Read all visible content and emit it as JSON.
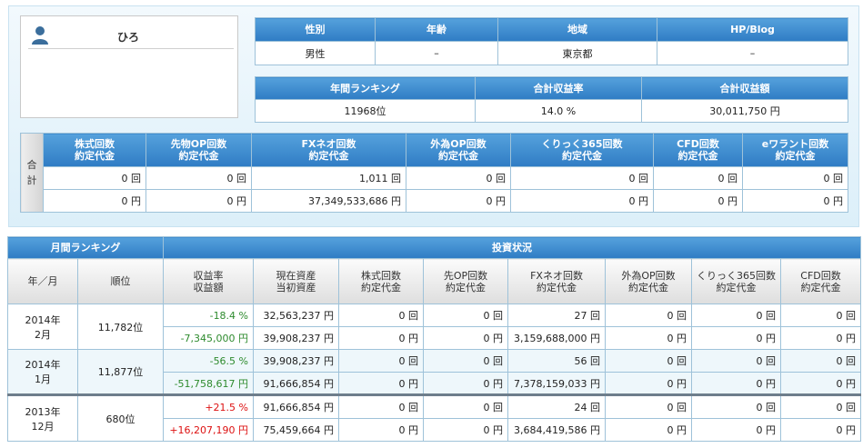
{
  "profile": {
    "name": "ひろ"
  },
  "info": {
    "headers": [
      "性別",
      "年齢",
      "地域",
      "HP/Blog"
    ],
    "values": [
      "男性",
      "–",
      "東京都",
      "–"
    ]
  },
  "summary": {
    "headers": [
      "年間ランキング",
      "合計収益率",
      "合計収益額"
    ],
    "values": [
      "11968位",
      "14.0 %",
      "30,011,750 円"
    ]
  },
  "totals": {
    "side_label": [
      "合",
      "計"
    ],
    "headers": [
      [
        "株式回数",
        "約定代金"
      ],
      [
        "先物OP回数",
        "約定代金"
      ],
      [
        "FXネオ回数",
        "約定代金"
      ],
      [
        "外為OP回数",
        "約定代金"
      ],
      [
        "くりっく365回数",
        "約定代金"
      ],
      [
        "CFD回数",
        "約定代金"
      ],
      [
        "eワラント回数",
        "約定代金"
      ]
    ],
    "counts": [
      "0 回",
      "0 回",
      "1,011 回",
      "0 回",
      "0 回",
      "0 回",
      "0 回"
    ],
    "amounts": [
      "0 円",
      "0 円",
      "37,349,533,686 円",
      "0 円",
      "0 円",
      "0 円",
      "0 円"
    ]
  },
  "monthly": {
    "ranking_header": "月間ランキング",
    "status_header": "投資状況",
    "columns": [
      [
        "年／月"
      ],
      [
        "順位"
      ],
      [
        "収益率",
        "収益額"
      ],
      [
        "現在資産",
        "当初資産"
      ],
      [
        "株式回数",
        "約定代金"
      ],
      [
        "先OP回数",
        "約定代金"
      ],
      [
        "FXネオ回数",
        "約定代金"
      ],
      [
        "外為OP回数",
        "約定代金"
      ],
      [
        "くりっく365回数",
        "約定代金"
      ],
      [
        "CFD回数",
        "約定代金"
      ]
    ],
    "rows": [
      {
        "ym": [
          "2014年",
          "2月"
        ],
        "rank": "11,782位",
        "line1": [
          "-18.4 %",
          "32,563,237 円",
          "0 回",
          "0 回",
          "27 回",
          "0 回",
          "0 回",
          "0 回"
        ],
        "line2": [
          "-7,345,000 円",
          "39,908,237 円",
          "0 円",
          "0 円",
          "3,159,688,000 円",
          "0 円",
          "0 円",
          "0 円"
        ]
      },
      {
        "ym": [
          "2014年",
          "1月"
        ],
        "rank": "11,877位",
        "line1": [
          "-56.5 %",
          "39,908,237 円",
          "0 回",
          "0 回",
          "56 回",
          "0 回",
          "0 回",
          "0 回"
        ],
        "line2": [
          "-51,758,617 円",
          "91,666,854 円",
          "0 円",
          "0 円",
          "7,378,159,033 円",
          "0 円",
          "0 円",
          "0 円"
        ]
      },
      {
        "ym": [
          "2013年",
          "12月"
        ],
        "rank": "680位",
        "line1": [
          "+21.5 %",
          "91,666,854 円",
          "0 回",
          "0 回",
          "24 回",
          "0 回",
          "0 回",
          "0 回"
        ],
        "line2": [
          "+16,207,190 円",
          "75,459,664 円",
          "0 円",
          "0 円",
          "3,684,419,586 円",
          "0 円",
          "0 円",
          "0 円"
        ]
      }
    ]
  },
  "colors": {
    "header_blue": "#3a86cc",
    "negative": "#2e8b2e",
    "positive": "#dd1111",
    "row_alt": "#eef7fb"
  }
}
